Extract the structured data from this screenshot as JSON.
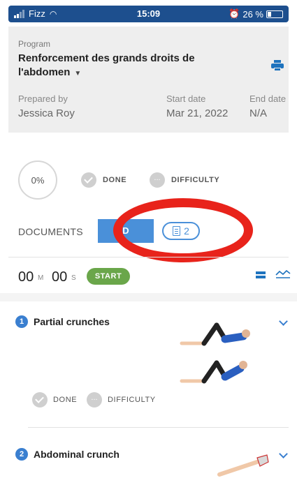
{
  "status_bar": {
    "carrier": "Fizz",
    "time": "15:09",
    "battery": "26 %"
  },
  "program": {
    "label": "Program",
    "title": "Renforcement des grands droits de l'abdomen",
    "prepared_by_label": "Prepared by",
    "prepared_by": "Jessica Roy",
    "start_date_label": "Start date",
    "start_date": "Mar 21, 2022",
    "end_date_label": "End date",
    "end_date": "N/A"
  },
  "progress": {
    "percent": "0%",
    "done_label": "DONE",
    "difficulty_label": "DIFFICULTY"
  },
  "documents": {
    "label": "DOCUMENTS",
    "tab_label": "D",
    "count": "2"
  },
  "timer": {
    "minutes": "00",
    "minutes_unit": "M",
    "seconds": "00",
    "seconds_unit": "S",
    "start_label": "START"
  },
  "exercises": [
    {
      "number": "1",
      "name": "Partial crunches",
      "done_label": "DONE",
      "difficulty_label": "DIFFICULTY"
    },
    {
      "number": "2",
      "name": "Abdominal crunch"
    }
  ],
  "colors": {
    "accent": "#1e73be",
    "start_green": "#6aa64a",
    "annotation_red": "#e8231b",
    "header_bg": "#eeeeee"
  }
}
